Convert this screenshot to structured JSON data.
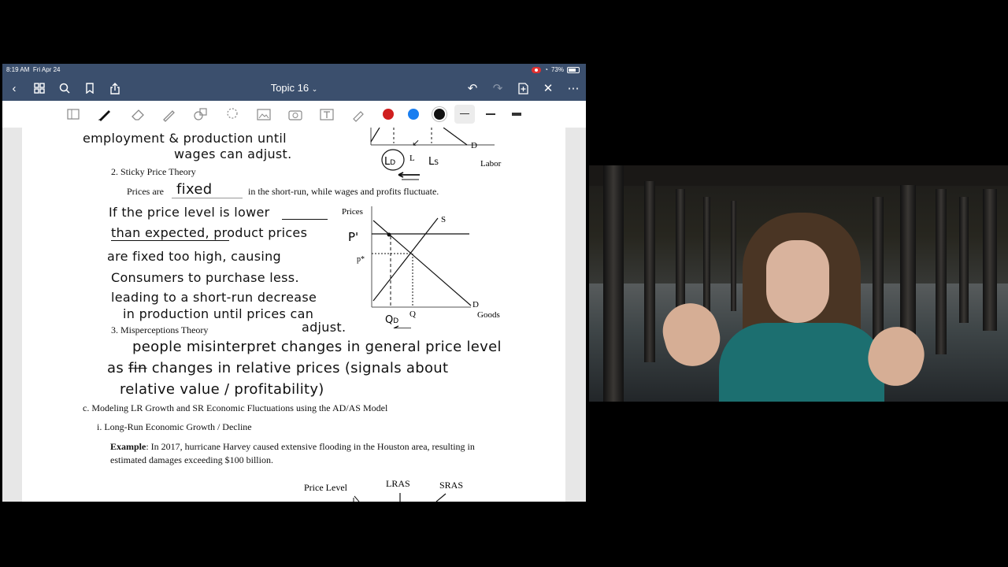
{
  "status": {
    "time": "8:19 AM",
    "date": "Fri Apr 24",
    "battery": "73%"
  },
  "nav": {
    "title": "Topic 16",
    "title_chevron": "⌄"
  },
  "colors": {
    "nav_bg": "#3b4f6d",
    "red": "#d01f1f",
    "blue": "#1a7ef0",
    "black": "#111111"
  },
  "toolbar": {
    "tools": [
      "sidebar-icon",
      "pen-icon",
      "eraser-icon",
      "pencil-icon",
      "shapes-icon",
      "lasso-icon",
      "image-icon",
      "camera-icon",
      "text-icon",
      "highlighter-icon"
    ]
  },
  "notes": {
    "hw_employment": "employment & production until",
    "hw_wages": "wages can adjust.",
    "item2": "2.   Sticky Price Theory",
    "prices_are": "Prices are",
    "fixed": "fixed",
    "prices_rest": "in the short-run, while wages and profits fluctuate.",
    "hw_line1": "If the price level is lower",
    "hw_line2": "than expected, product prices",
    "hw_line3": "are fixed too high, causing",
    "hw_line4": "Consumers to purchase less.",
    "hw_line5": "leading to a short-run decrease",
    "hw_line6": "in production until prices can",
    "hw_line7": "adjust.",
    "item3": "3.   Misperceptions Theory",
    "hw_mis1": "people misinterpret changes in general price level",
    "hw_mis2_a": "as",
    "hw_mis2_strike": "fin",
    "hw_mis2_b": "changes in relative prices (signals about",
    "hw_mis3": "relative value / profitability)",
    "section_c": "c.   Modeling LR Growth and SR Economic Fluctuations using the AD/AS Model",
    "item_i": "i.    Long-Run Economic Growth / Decline",
    "example_bold": "Example",
    "example_text": ": In 2017, hurricane Harvey caused extensive flooding in the Houston area, resulting in",
    "example_text2": "estimated damages exceeding $100 billion."
  },
  "labor_graph": {
    "d_label": "D",
    "l_label": "L",
    "ld_label": "LD",
    "ls_label": "LS",
    "x_label": "Labor"
  },
  "goods_graph": {
    "y_label": "Prices",
    "s_label": "S",
    "d_label": "D",
    "x_label": "Goods",
    "p_prime": "P'",
    "p_star": "p*",
    "q_label": "Q",
    "qd_label": "QD"
  },
  "adas_graph": {
    "y_label": "Price Level",
    "lras": "LRAS",
    "sras": "SRAS"
  }
}
